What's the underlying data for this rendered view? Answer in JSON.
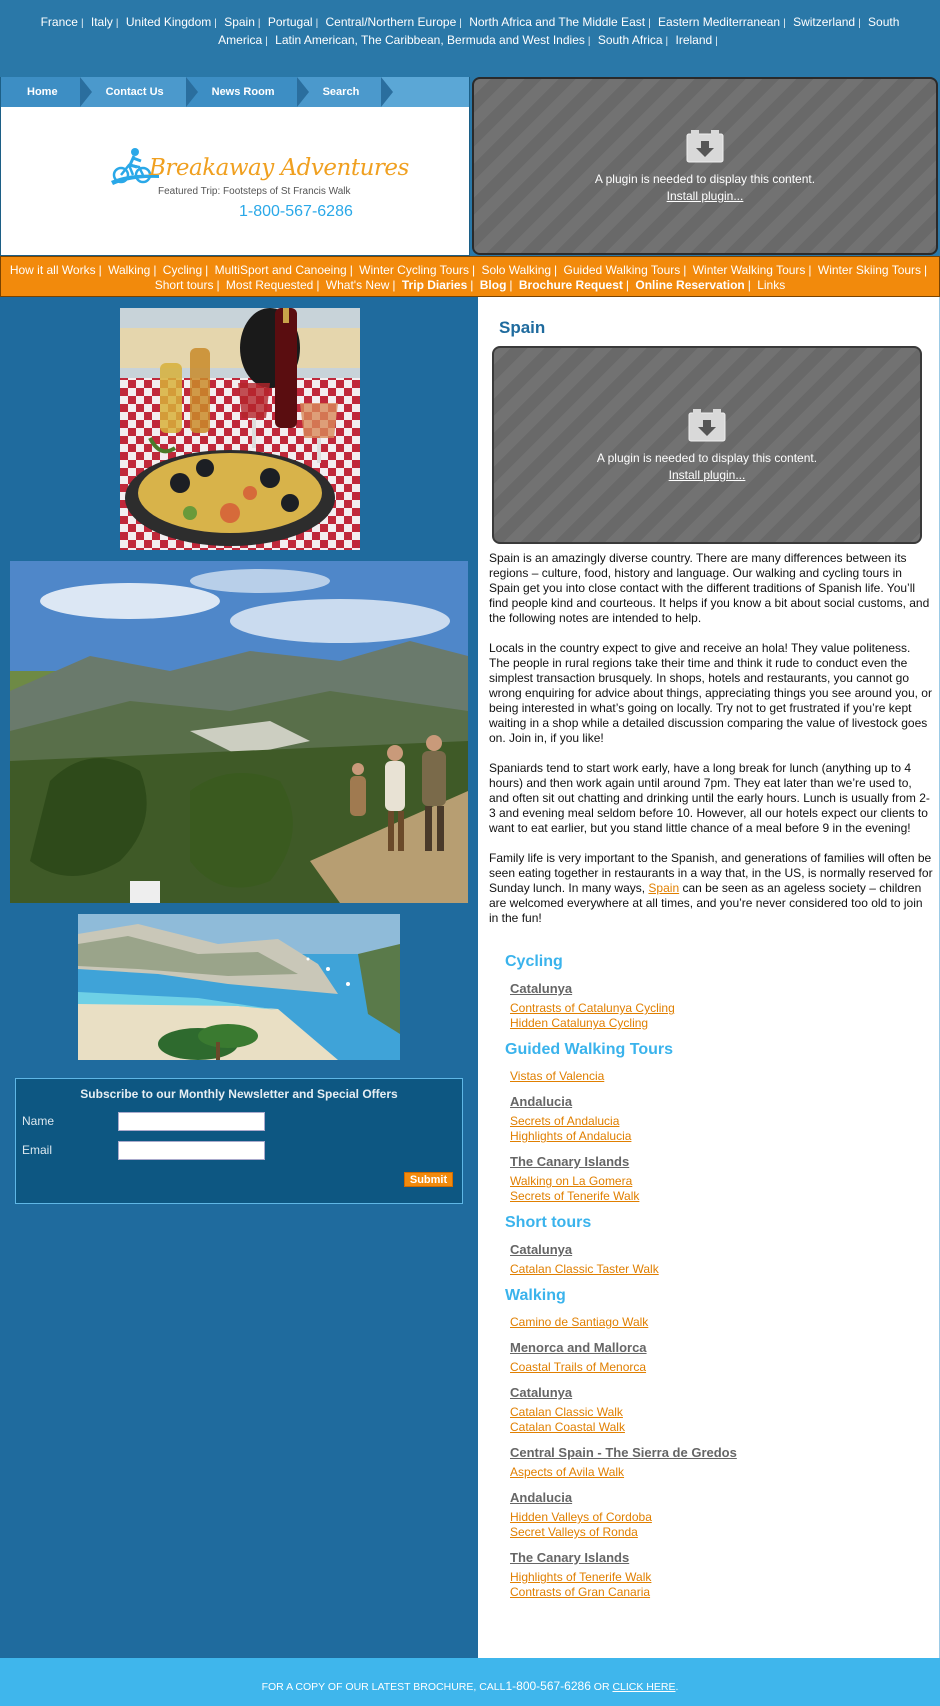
{
  "region_nav": [
    "France",
    "Italy",
    "United Kingdom",
    "Spain",
    "Portugal",
    "Central/Northern Europe",
    "North Africa and The Middle East",
    "Eastern Mediterranean",
    "Switzerland",
    "South America",
    "Latin American, The Caribbean, Bermuda and West Indies",
    "South Africa",
    "Ireland"
  ],
  "main_nav": [
    "Home",
    "Contact Us",
    "News Room",
    "Search"
  ],
  "logo": {
    "name": "Breakaway Adventures",
    "featured": "Featured Trip: Footsteps of St Francis Walk",
    "phone": "1-800-567-6286"
  },
  "plugin": {
    "message": "A plugin is needed to display this content.",
    "install": "Install plugin..."
  },
  "categories": [
    {
      "label": "How it all Works",
      "bold": false
    },
    {
      "label": "Walking",
      "bold": false
    },
    {
      "label": "Cycling",
      "bold": false
    },
    {
      "label": "MultiSport and Canoeing",
      "bold": false
    },
    {
      "label": "Winter Cycling Tours",
      "bold": false
    },
    {
      "label": "Solo Walking",
      "bold": false
    },
    {
      "label": "Guided Walking Tours",
      "bold": false
    },
    {
      "label": "Winter Walking Tours",
      "bold": false
    },
    {
      "label": "Winter Skiing Tours",
      "bold": false
    },
    {
      "label": "Short tours",
      "bold": false
    },
    {
      "label": "Most Requested",
      "bold": false
    },
    {
      "label": "What's New",
      "bold": false
    },
    {
      "label": "Trip Diaries",
      "bold": true
    },
    {
      "label": "Blog",
      "bold": true
    },
    {
      "label": "Brochure Request",
      "bold": true
    },
    {
      "label": "Online Reservation",
      "bold": true
    },
    {
      "label": "Links",
      "bold": false
    }
  ],
  "newsletter": {
    "title": "Subscribe to our Monthly Newsletter and Special Offers",
    "name_label": "Name",
    "email_label": "Email",
    "name_value": "",
    "email_value": "",
    "submit": "Submit"
  },
  "page": {
    "title": "Spain",
    "paragraphs": [
      "Spain is an amazingly diverse country. There are many differences between its regions – culture, food, history and language. Our walking and cycling tours in Spain get you into close contact with the different traditions of Spanish life. You’ll find people kind and courteous. It helps if you know a bit about social customs, and the following notes are intended to help.",
      "Locals in the country expect to give and receive an hola! They value politeness. The people in rural regions take their time and think it rude to conduct even the simplest transaction brusquely. In shops, hotels and restaurants, you cannot go wrong enquiring for advice about things, appreciating things you see around you, or being interested in what’s going on locally. Try not to get frustrated if you’re kept waiting in a shop while a detailed discussion comparing the value of livestock goes on. Join in, if you like!",
      "Spaniards tend to start work early, have a long break for lunch (anything up to 4 hours) and then work again until around 7pm. They eat later than we’re used to, and often sit out chatting and drinking until the early hours. Lunch is usually from 2-3 and evening meal seldom before 10. However, all our hotels expect our clients to want to eat earlier, but you stand little chance of a meal before 9 in the evening!"
    ],
    "last_paragraph_before": "Family life is very important to the Spanish, and generations of families will often be seen eating together in restaurants in a way that, in the US, is normally reserved for Sunday lunch. In many ways, ",
    "last_paragraph_link": "Spain",
    "last_paragraph_after": " can be seen as an ageless society – children are welcomed everywhere at all times, and you’re never considered too old to join in the fun!"
  },
  "tours": [
    {
      "category": "Cycling",
      "groups": [
        {
          "region": "Catalunya",
          "links": [
            "Contrasts of Catalunya Cycling",
            "Hidden Catalunya Cycling"
          ]
        }
      ]
    },
    {
      "category": "Guided Walking Tours",
      "groups": [
        {
          "region": "",
          "links": [
            "Vistas of Valencia"
          ]
        },
        {
          "region": "Andalucia",
          "links": [
            "Secrets of Andalucia",
            "Highlights of Andalucia"
          ]
        },
        {
          "region": "The Canary Islands",
          "links": [
            "Walking on La Gomera",
            "Secrets of Tenerife Walk"
          ]
        }
      ]
    },
    {
      "category": "Short tours",
      "groups": [
        {
          "region": "Catalunya",
          "links": [
            "Catalan Classic Taster Walk"
          ]
        }
      ]
    },
    {
      "category": "Walking",
      "groups": [
        {
          "region": "",
          "links": [
            "Camino de Santiago Walk"
          ]
        },
        {
          "region": "Menorca and Mallorca",
          "links": [
            "Coastal Trails of Menorca"
          ]
        },
        {
          "region": "Catalunya",
          "links": [
            "Catalan Classic Walk",
            "Catalan Coastal Walk"
          ]
        },
        {
          "region": "Central Spain - The Sierra de Gredos",
          "links": [
            "Aspects of Avila Walk"
          ]
        },
        {
          "region": "Andalucia",
          "links": [
            "Hidden Valleys of Cordoba",
            "Secret Valleys of Ronda"
          ]
        },
        {
          "region": "The Canary Islands",
          "links": [
            "Highlights of Tenerife Walk",
            "Contrasts of Gran Canaria"
          ]
        }
      ]
    }
  ],
  "footer": {
    "text_before": "FOR A COPY OF OUR LATEST BROCHURE, CALL",
    "phone": "1-800-567-6286",
    "text_or": " OR ",
    "click": "CLICK HERE",
    "period": "."
  },
  "colors": {
    "top_bar": "#2a78a8",
    "category_bar": "#f28a0c",
    "left_column": "#1f6b9e",
    "footer": "#3fb6ec",
    "link_orange": "#e07f00",
    "heading_blue": "#3ab3ec"
  }
}
